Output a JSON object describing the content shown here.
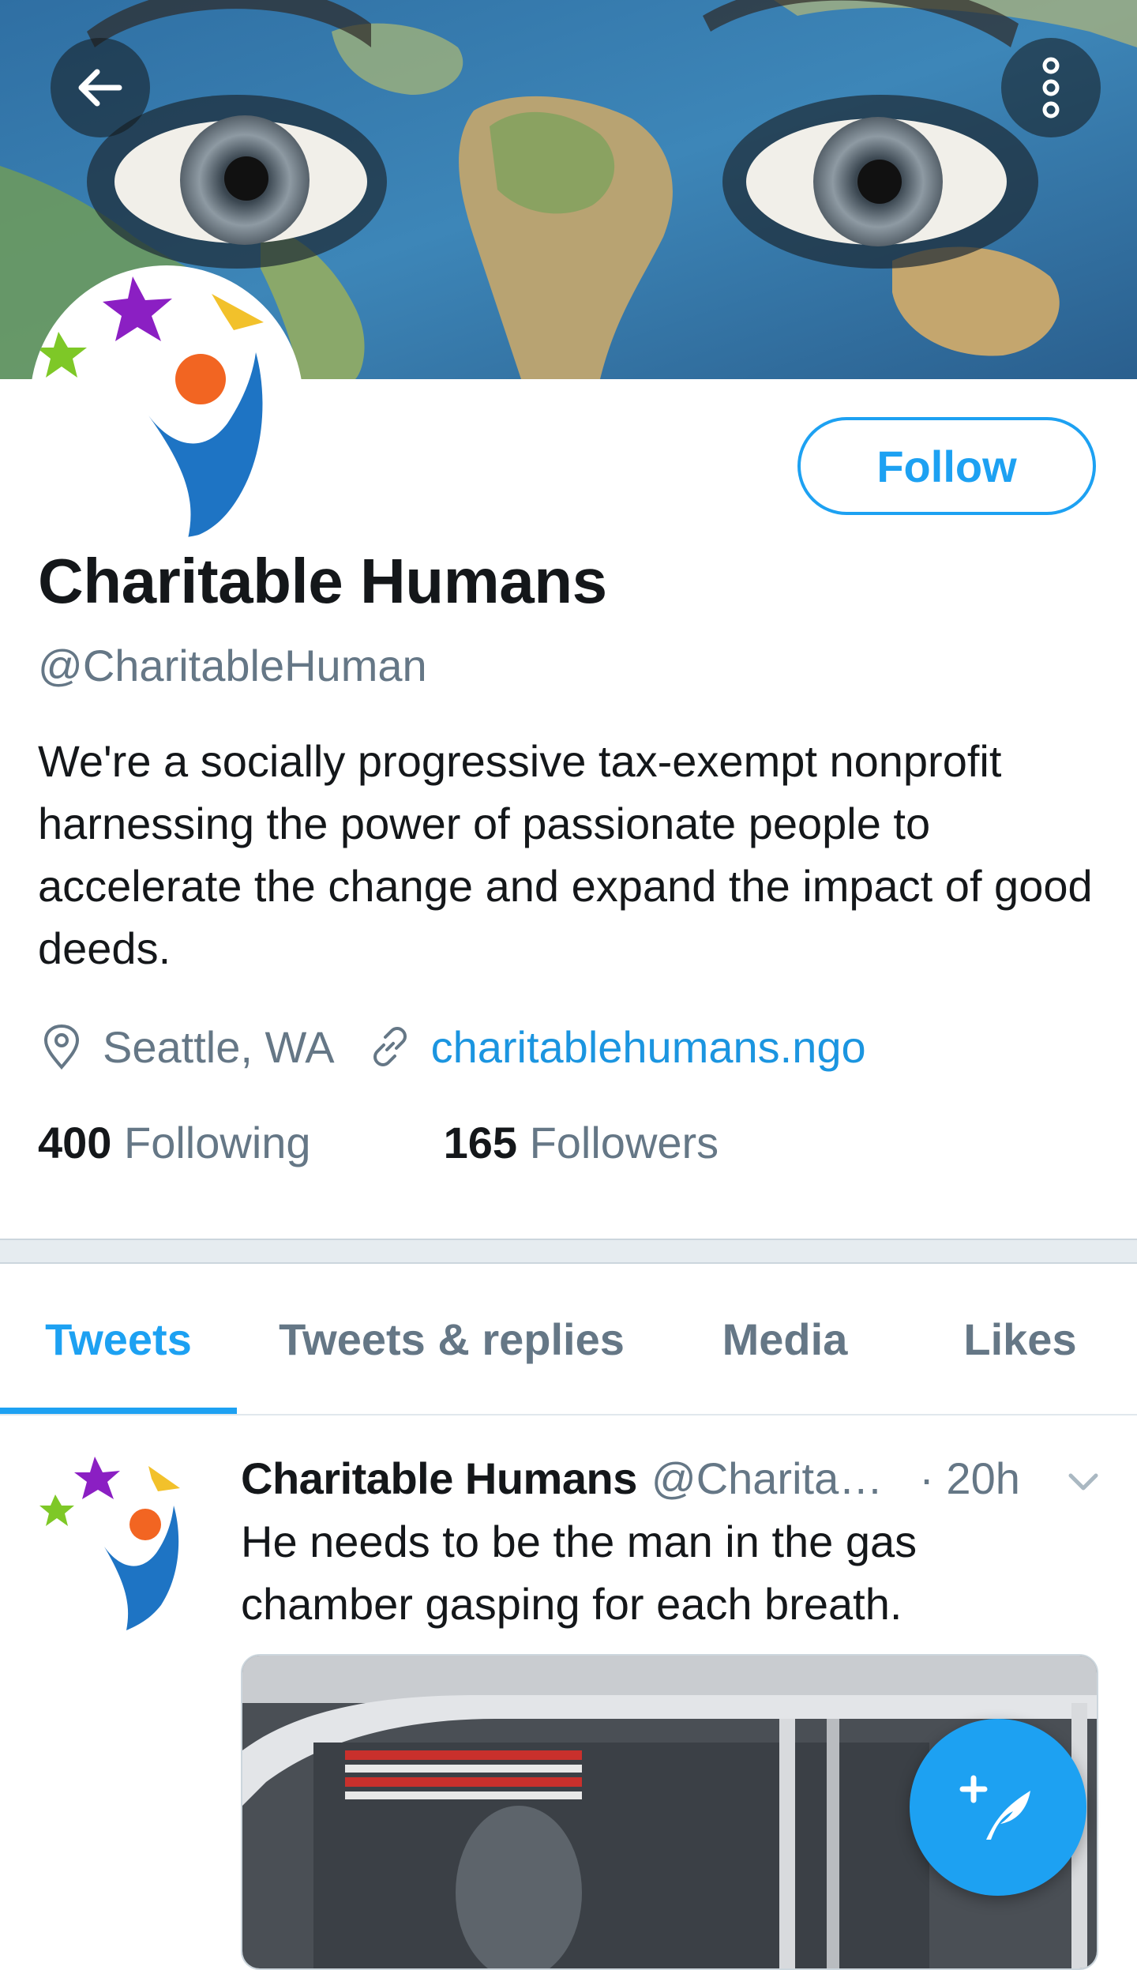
{
  "colors": {
    "accent": "#1da1f2",
    "link": "#1b95e0",
    "text": "#14171a",
    "muted": "#657786"
  },
  "header": {
    "back_icon": "arrow-left-icon",
    "more_icon": "more-vertical-icon"
  },
  "profile": {
    "follow_label": "Follow",
    "display_name": "Charitable Humans",
    "handle": "@CharitableHuman",
    "bio": "We're a socially progressive tax-exempt nonprofit harnessing the power of passionate people to accelerate the change and expand the impact of good deeds.",
    "location": "Seattle, WA",
    "website": "charitablehumans.ngo",
    "following_count": "400",
    "following_label": "Following",
    "followers_count": "165",
    "followers_label": "Followers"
  },
  "tabs": [
    {
      "label": "Tweets",
      "active": true
    },
    {
      "label": "Tweets & replies"
    },
    {
      "label": "Media"
    },
    {
      "label": "Likes"
    }
  ],
  "tweet": {
    "name": "Charitable Humans",
    "handle": "@Charita…",
    "time": "· 20h",
    "text": "He needs to be the man in the gas chamber gasping for each breath."
  },
  "fab": {
    "icon": "compose-tweet-icon"
  }
}
